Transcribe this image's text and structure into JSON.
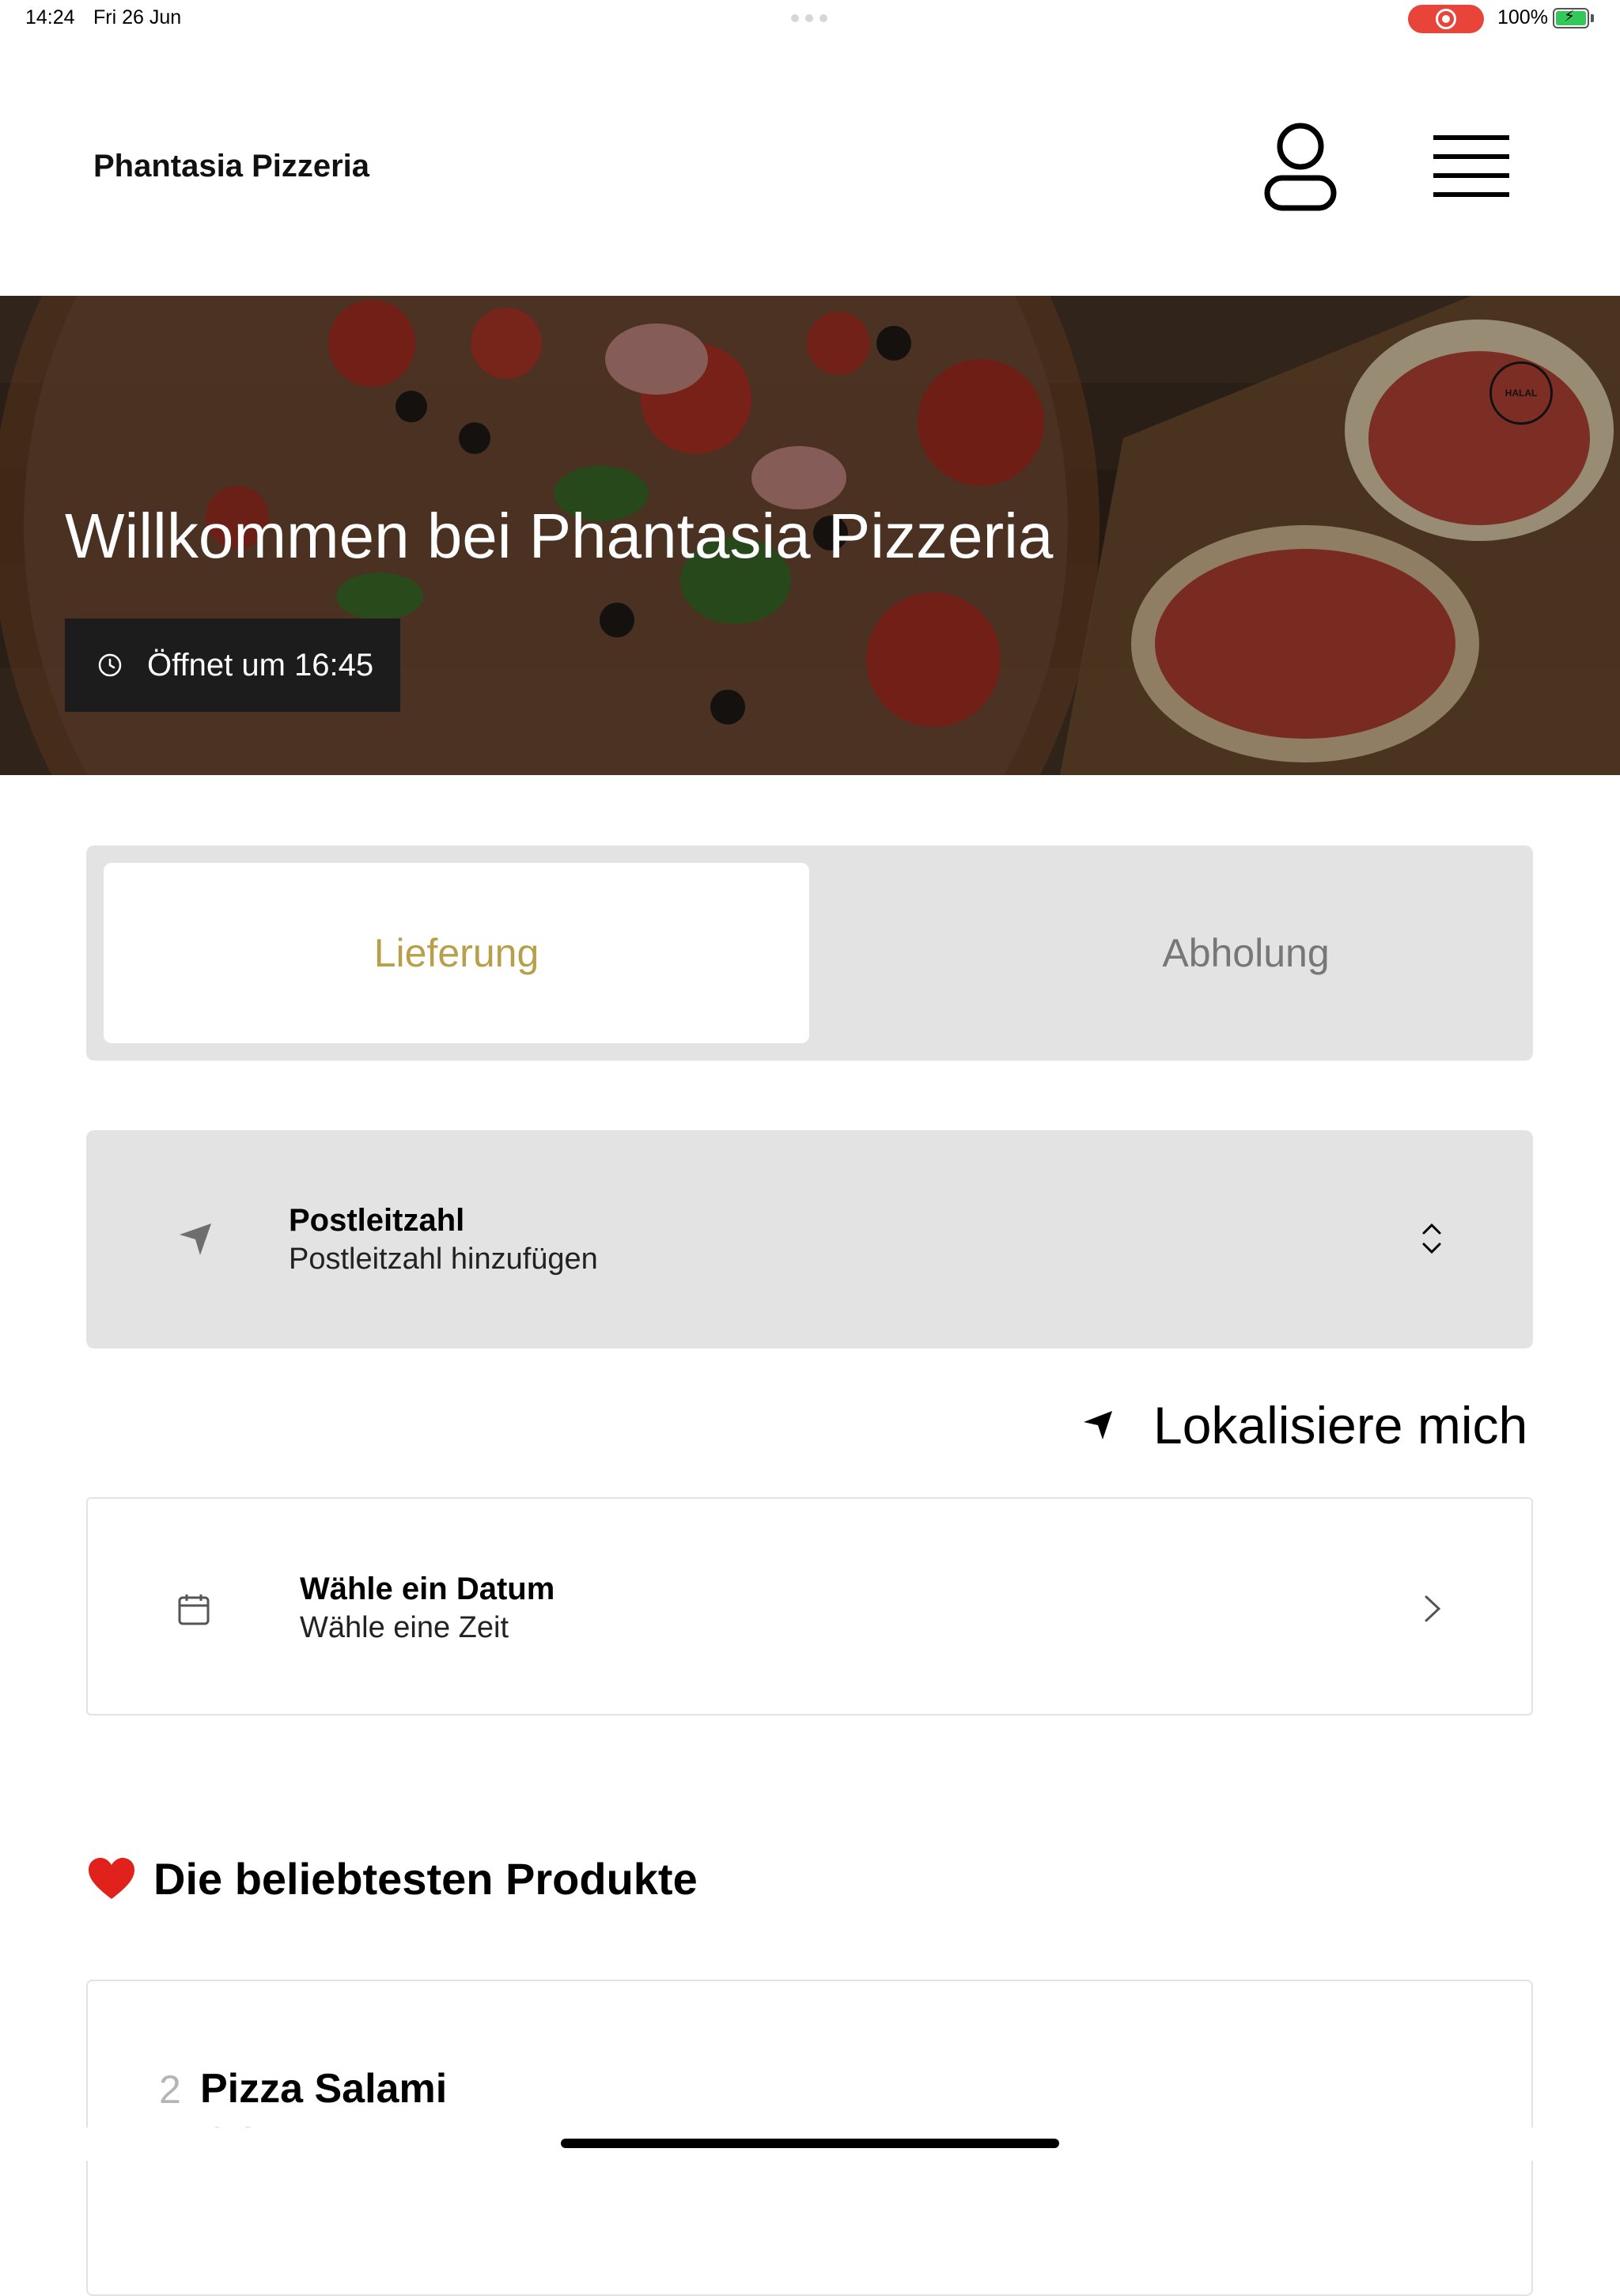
{
  "status_bar": {
    "time": "14:24",
    "date": "Fri 26 Jun",
    "battery": "100%"
  },
  "header": {
    "brand": "Phantasia Pizzeria",
    "profile_icon": "person-icon",
    "menu_icon": "hamburger-menu-icon"
  },
  "hero": {
    "title": "Willkommen bei Phantasia Pizzeria",
    "hours": "Öffnet um 16:45",
    "badge": "HALAL"
  },
  "order_mode": {
    "tabs": [
      {
        "label": "Lieferung",
        "active": true
      },
      {
        "label": "Abholung",
        "active": false
      }
    ],
    "active_color": "#b8a04a"
  },
  "postal": {
    "label": "Postleitzahl",
    "value": "Postleitzahl hinzufügen"
  },
  "locate": {
    "label": "Lokalisiere mich"
  },
  "schedule": {
    "date_label": "Wähle ein Datum",
    "time_label": "Wähle eine Zeit"
  },
  "popular": {
    "title": "Die beliebtesten Produkte",
    "products": [
      {
        "qty": "2",
        "name": "Pizza Salami",
        "price": "5,50 €"
      }
    ]
  }
}
